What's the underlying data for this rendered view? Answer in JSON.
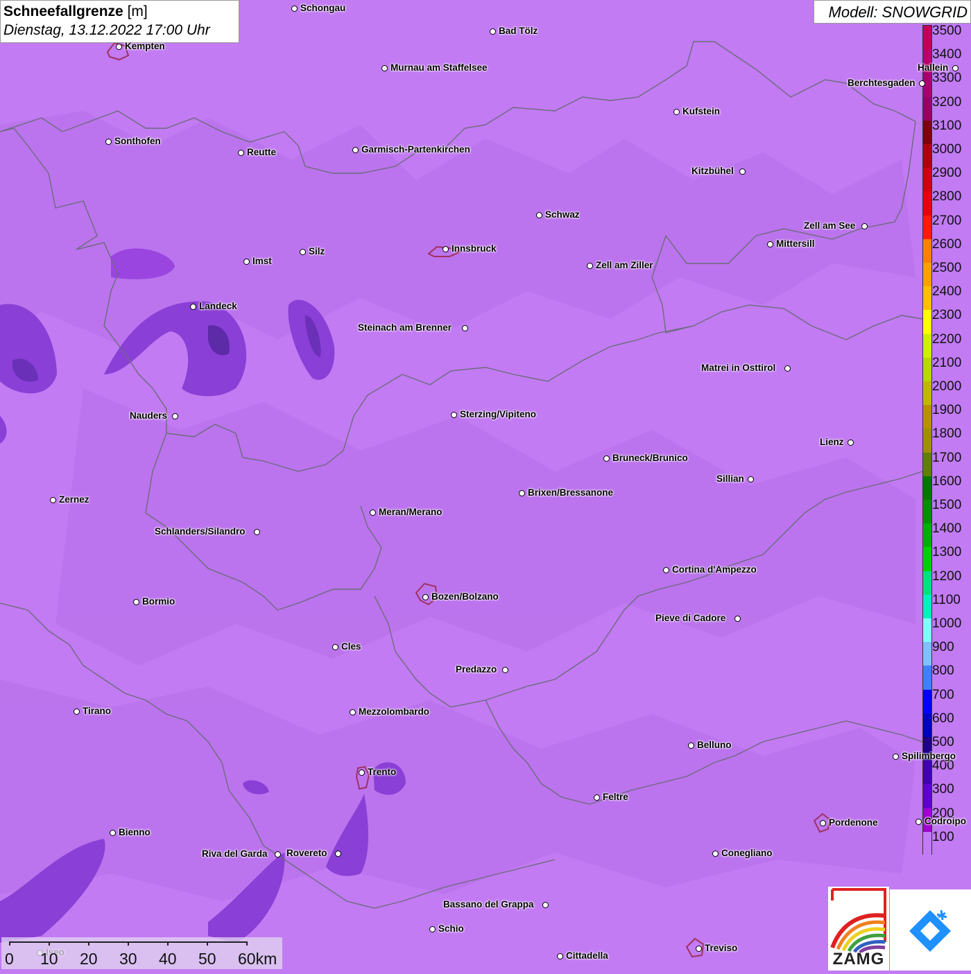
{
  "title": {
    "main": "Schneefallgrenze",
    "unit": "[m]",
    "datetime": "Dienstag, 13.12.2022 17:00 Uhr"
  },
  "model": "Modell: SNOWGRID",
  "colors": {
    "background": "#c27bf3",
    "border": "#6b6b7a",
    "low_snowline": "#8a3fd6",
    "lowest_snowline": "#5d2aa8"
  },
  "legend": {
    "labels": [
      "3500",
      "3400",
      "3300",
      "3200",
      "3100",
      "3000",
      "2900",
      "2800",
      "2700",
      "2600",
      "2500",
      "2400",
      "2300",
      "2200",
      "2100",
      "2000",
      "1900",
      "1800",
      "1700",
      "1600",
      "1500",
      "1400",
      "1300",
      "1200",
      "1100",
      "1000",
      "900",
      "800",
      "700",
      "600",
      "500",
      "400",
      "300",
      "200",
      "100"
    ],
    "colors": [
      "#c2005c",
      "#b8006e",
      "#a80070",
      "#990066",
      "#800010",
      "#b00010",
      "#d00010",
      "#e80010",
      "#ff1a00",
      "#ff8000",
      "#ffa000",
      "#ffc000",
      "#ffff00",
      "#ccf000",
      "#b8d800",
      "#c0b800",
      "#b89000",
      "#a09000",
      "#608000",
      "#007800",
      "#009000",
      "#00b000",
      "#00d000",
      "#00e080",
      "#00f0c0",
      "#80ffff",
      "#80c0ff",
      "#4080ff",
      "#0000ff",
      "#0000c0",
      "#200080",
      "#4000b0",
      "#6000d0",
      "#a000d0",
      "#c27bf3"
    ]
  },
  "cities": [
    {
      "name": "Schongau"
    },
    {
      "name": "Bad Tölz"
    },
    {
      "name": "Kempten"
    },
    {
      "name": "Murnau am Staffelsee"
    },
    {
      "name": "Kufstein"
    },
    {
      "name": "Berchtesgaden"
    },
    {
      "name": "Hallein"
    },
    {
      "name": "Sonthofen"
    },
    {
      "name": "Reutte"
    },
    {
      "name": "Garmisch-Partenkirchen"
    },
    {
      "name": "Kitzbühel"
    },
    {
      "name": "Schwaz"
    },
    {
      "name": "Zell am See"
    },
    {
      "name": "Mittersill"
    },
    {
      "name": "Imst"
    },
    {
      "name": "Silz"
    },
    {
      "name": "Innsbruck"
    },
    {
      "name": "Zell am Ziller"
    },
    {
      "name": "Landeck"
    },
    {
      "name": "Steinach am Brenner"
    },
    {
      "name": "Matrei in Osttirol"
    },
    {
      "name": "Nauders"
    },
    {
      "name": "Sterzing/Vipiteno"
    },
    {
      "name": "Lienz"
    },
    {
      "name": "Bruneck/Brunico"
    },
    {
      "name": "Sillian"
    },
    {
      "name": "Zernez"
    },
    {
      "name": "Brixen/Bressanone"
    },
    {
      "name": "Meran/Merano"
    },
    {
      "name": "Schlanders/Silandro"
    },
    {
      "name": "Cortina d'Ampezzo"
    },
    {
      "name": "Bozen/Bolzano"
    },
    {
      "name": "Bormio"
    },
    {
      "name": "Pieve di Cadore"
    },
    {
      "name": "Cles"
    },
    {
      "name": "Predazzo"
    },
    {
      "name": "Tirano"
    },
    {
      "name": "Mezzolombardo"
    },
    {
      "name": "Belluno"
    },
    {
      "name": "Spilimbergo"
    },
    {
      "name": "Trento"
    },
    {
      "name": "Feltre"
    },
    {
      "name": "Pordenone"
    },
    {
      "name": "Codroipo"
    },
    {
      "name": "Bienno"
    },
    {
      "name": "Riva del Garda"
    },
    {
      "name": "Rovereto"
    },
    {
      "name": "Conegliano"
    },
    {
      "name": "Bassano del Grappa"
    },
    {
      "name": "Schio"
    },
    {
      "name": "Iseo"
    },
    {
      "name": "Treviso"
    },
    {
      "name": "Cittadella"
    }
  ],
  "scale": {
    "labels": [
      "0",
      "10",
      "20",
      "30",
      "40",
      "50",
      "60km"
    ]
  },
  "logo": {
    "text": "ZAMG"
  }
}
